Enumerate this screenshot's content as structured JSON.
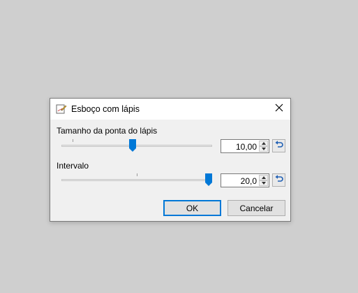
{
  "dialog": {
    "title": "Esboço com lápis",
    "title_icon": "pencil-sketch-icon",
    "close_icon": "close-icon"
  },
  "pencil_tip_size": {
    "label": "Tamanho da ponta do lápis",
    "value": "10,00",
    "slider_fraction": 0.47
  },
  "interval": {
    "label": "Intervalo",
    "value": "20,0",
    "slider_fraction": 1.0
  },
  "buttons": {
    "ok_label": "OK",
    "cancel_label": "Cancelar"
  },
  "colors": {
    "accent": "#0078d7",
    "dialog_bg": "#f0f0f0",
    "desktop_bg": "#cfcfcf"
  }
}
